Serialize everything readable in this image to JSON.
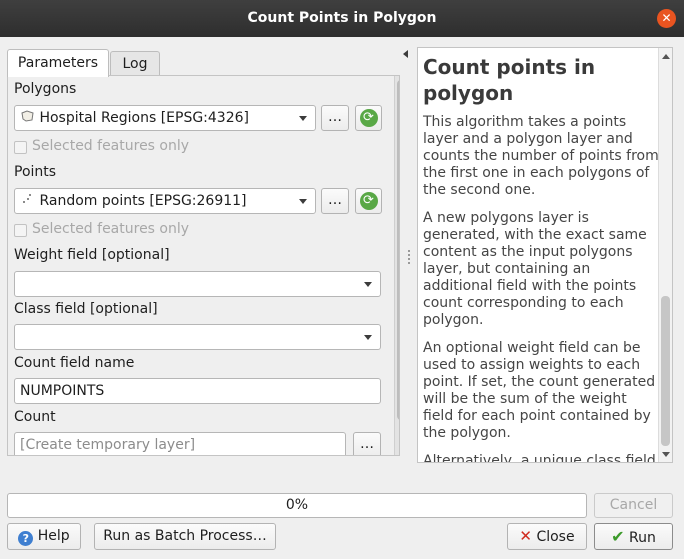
{
  "window": {
    "title": "Count Points in Polygon"
  },
  "tabs": [
    {
      "label": "Parameters"
    },
    {
      "label": "Log"
    }
  ],
  "params": {
    "polygons": {
      "label": "Polygons",
      "value": "Hospital Regions [EPSG:4326]",
      "icon": "polygon-layer-icon",
      "browse": "…",
      "selected_only": "Selected features only"
    },
    "points": {
      "label": "Points",
      "value": "Random points [EPSG:26911]",
      "icon": "point-layer-icon",
      "browse": "…",
      "selected_only": "Selected features only"
    },
    "weight": {
      "label": "Weight field [optional]",
      "value": ""
    },
    "class": {
      "label": "Class field [optional]",
      "value": ""
    },
    "count_field": {
      "label": "Count field name",
      "value": "NUMPOINTS"
    },
    "count": {
      "label": "Count",
      "placeholder": "[Create temporary layer]",
      "browse": "…"
    }
  },
  "help": {
    "title": "Count points in polygon",
    "paragraphs": [
      "This algorithm takes a points layer and a polygon layer and counts the number of points from the first one in each polygons of the second one.",
      "A new polygons layer is generated, with the exact same content as the input polygons layer, but containing an additional field with the points count corresponding to each polygon.",
      "An optional weight field can be used to assign weights to each point. If set, the count generated will be the sum of the weight field for each point contained by the polygon.",
      "Alternatively, a unique class field can be specified. If set, points are classified based on the selected attribute, and if several points with the same attribute value are within the polygon, only one of them is counted."
    ]
  },
  "progress": {
    "value": 0,
    "label": "0%"
  },
  "buttons": {
    "cancel": "Cancel",
    "help": "Help",
    "batch": "Run as Batch Process…",
    "close": "Close",
    "run": "Run"
  },
  "colors": {
    "title_close": "#e95420",
    "help_icon": "#3f7fd0",
    "refresh_icon": "#59a846"
  }
}
